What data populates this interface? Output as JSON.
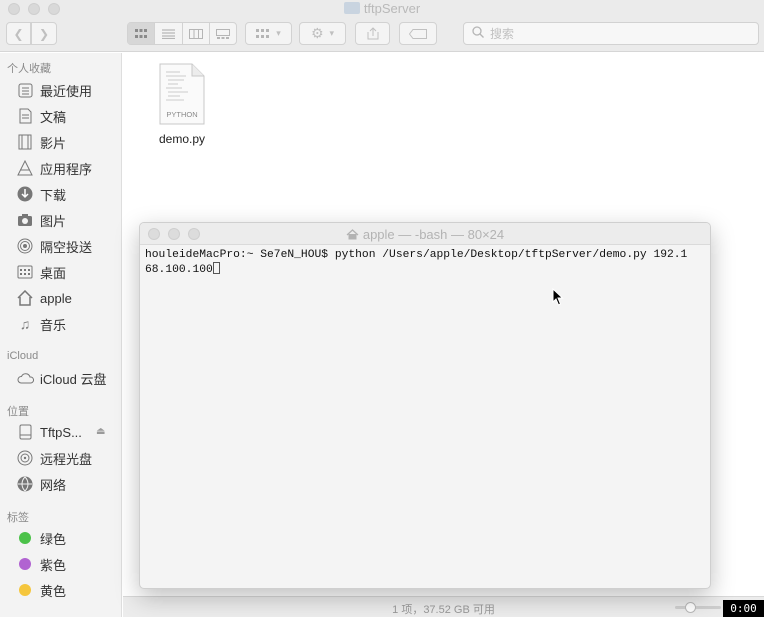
{
  "finder": {
    "window_title": "tftpServer",
    "search_placeholder": "搜索",
    "sidebar": {
      "favorites_header": "个人收藏",
      "favorites": [
        {
          "label": "最近使用",
          "icon": "recents-icon"
        },
        {
          "label": "文稿",
          "icon": "documents-icon"
        },
        {
          "label": "影片",
          "icon": "movies-icon"
        },
        {
          "label": "应用程序",
          "icon": "applications-icon"
        },
        {
          "label": "下载",
          "icon": "downloads-icon"
        },
        {
          "label": "图片",
          "icon": "pictures-icon"
        },
        {
          "label": "隔空投送",
          "icon": "airdrop-icon"
        },
        {
          "label": "桌面",
          "icon": "desktop-icon"
        },
        {
          "label": "apple",
          "icon": "home-icon"
        },
        {
          "label": "音乐",
          "icon": "music-icon"
        }
      ],
      "icloud_header": "iCloud",
      "icloud": [
        {
          "label": "iCloud 云盘",
          "icon": "cloud-icon"
        }
      ],
      "locations_header": "位置",
      "locations": [
        {
          "label": "TftpS...",
          "icon": "disk-icon"
        },
        {
          "label": "远程光盘",
          "icon": "optical-disc-icon"
        },
        {
          "label": "网络",
          "icon": "network-icon"
        }
      ],
      "tags_header": "标签",
      "tags": [
        {
          "label": "绿色",
          "color": "#4cc24a"
        },
        {
          "label": "紫色",
          "color": "#b163d1"
        },
        {
          "label": "黄色",
          "color": "#f5c63d"
        }
      ]
    },
    "files": [
      {
        "name": "demo.py",
        "type_label": "PYTHON"
      }
    ],
    "status_text": "1 项，37.52 GB 可用"
  },
  "terminal": {
    "title": "apple — -bash — 80×24",
    "lines": [
      "houleideMacPro:~ Se7eN_HOU$ python /Users/apple/Desktop/tftpServer/demo.py 192.1",
      "68.100.100"
    ]
  },
  "timer": "0:00"
}
